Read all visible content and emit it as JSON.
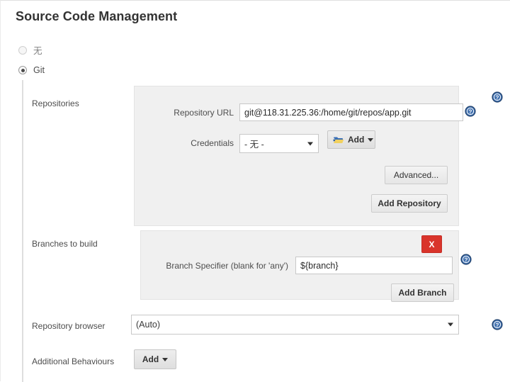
{
  "page": {
    "title": "Source Code Management"
  },
  "scm_options": [
    {
      "label": "无",
      "selected": false,
      "name": "none"
    },
    {
      "label": "Git",
      "selected": true,
      "name": "git"
    }
  ],
  "rows": {
    "repositories_label": "Repositories",
    "branches_label": "Branches to build",
    "repository_browser_label": "Repository browser",
    "additional_behaviours_label": "Additional Behaviours"
  },
  "repository": {
    "url_label": "Repository URL",
    "url_value": "git@118.31.225.36:/home/git/repos/app.git",
    "credentials_label": "Credentials",
    "credentials_value": "- 无 -",
    "credentials_add_label": "Add",
    "advanced_label": "Advanced...",
    "add_repository_label": "Add Repository"
  },
  "branches": {
    "specifier_label": "Branch Specifier (blank for 'any')",
    "specifier_value": "${branch}",
    "delete_label": "X",
    "add_branch_label": "Add Branch"
  },
  "repository_browser": {
    "value": "(Auto)"
  },
  "additional_behaviours": {
    "add_label": "Add"
  },
  "icons": {
    "help": "help-circle-icon",
    "credentials": "credentials-folder-icon",
    "caret": "chevron-down-icon"
  },
  "colors": {
    "panel_bg": "#f0f0f0",
    "panel_border": "#e3e3e3",
    "delete_red": "#d9342b",
    "help_blue": "#2a5d9e",
    "text": "#4d4d4d"
  }
}
